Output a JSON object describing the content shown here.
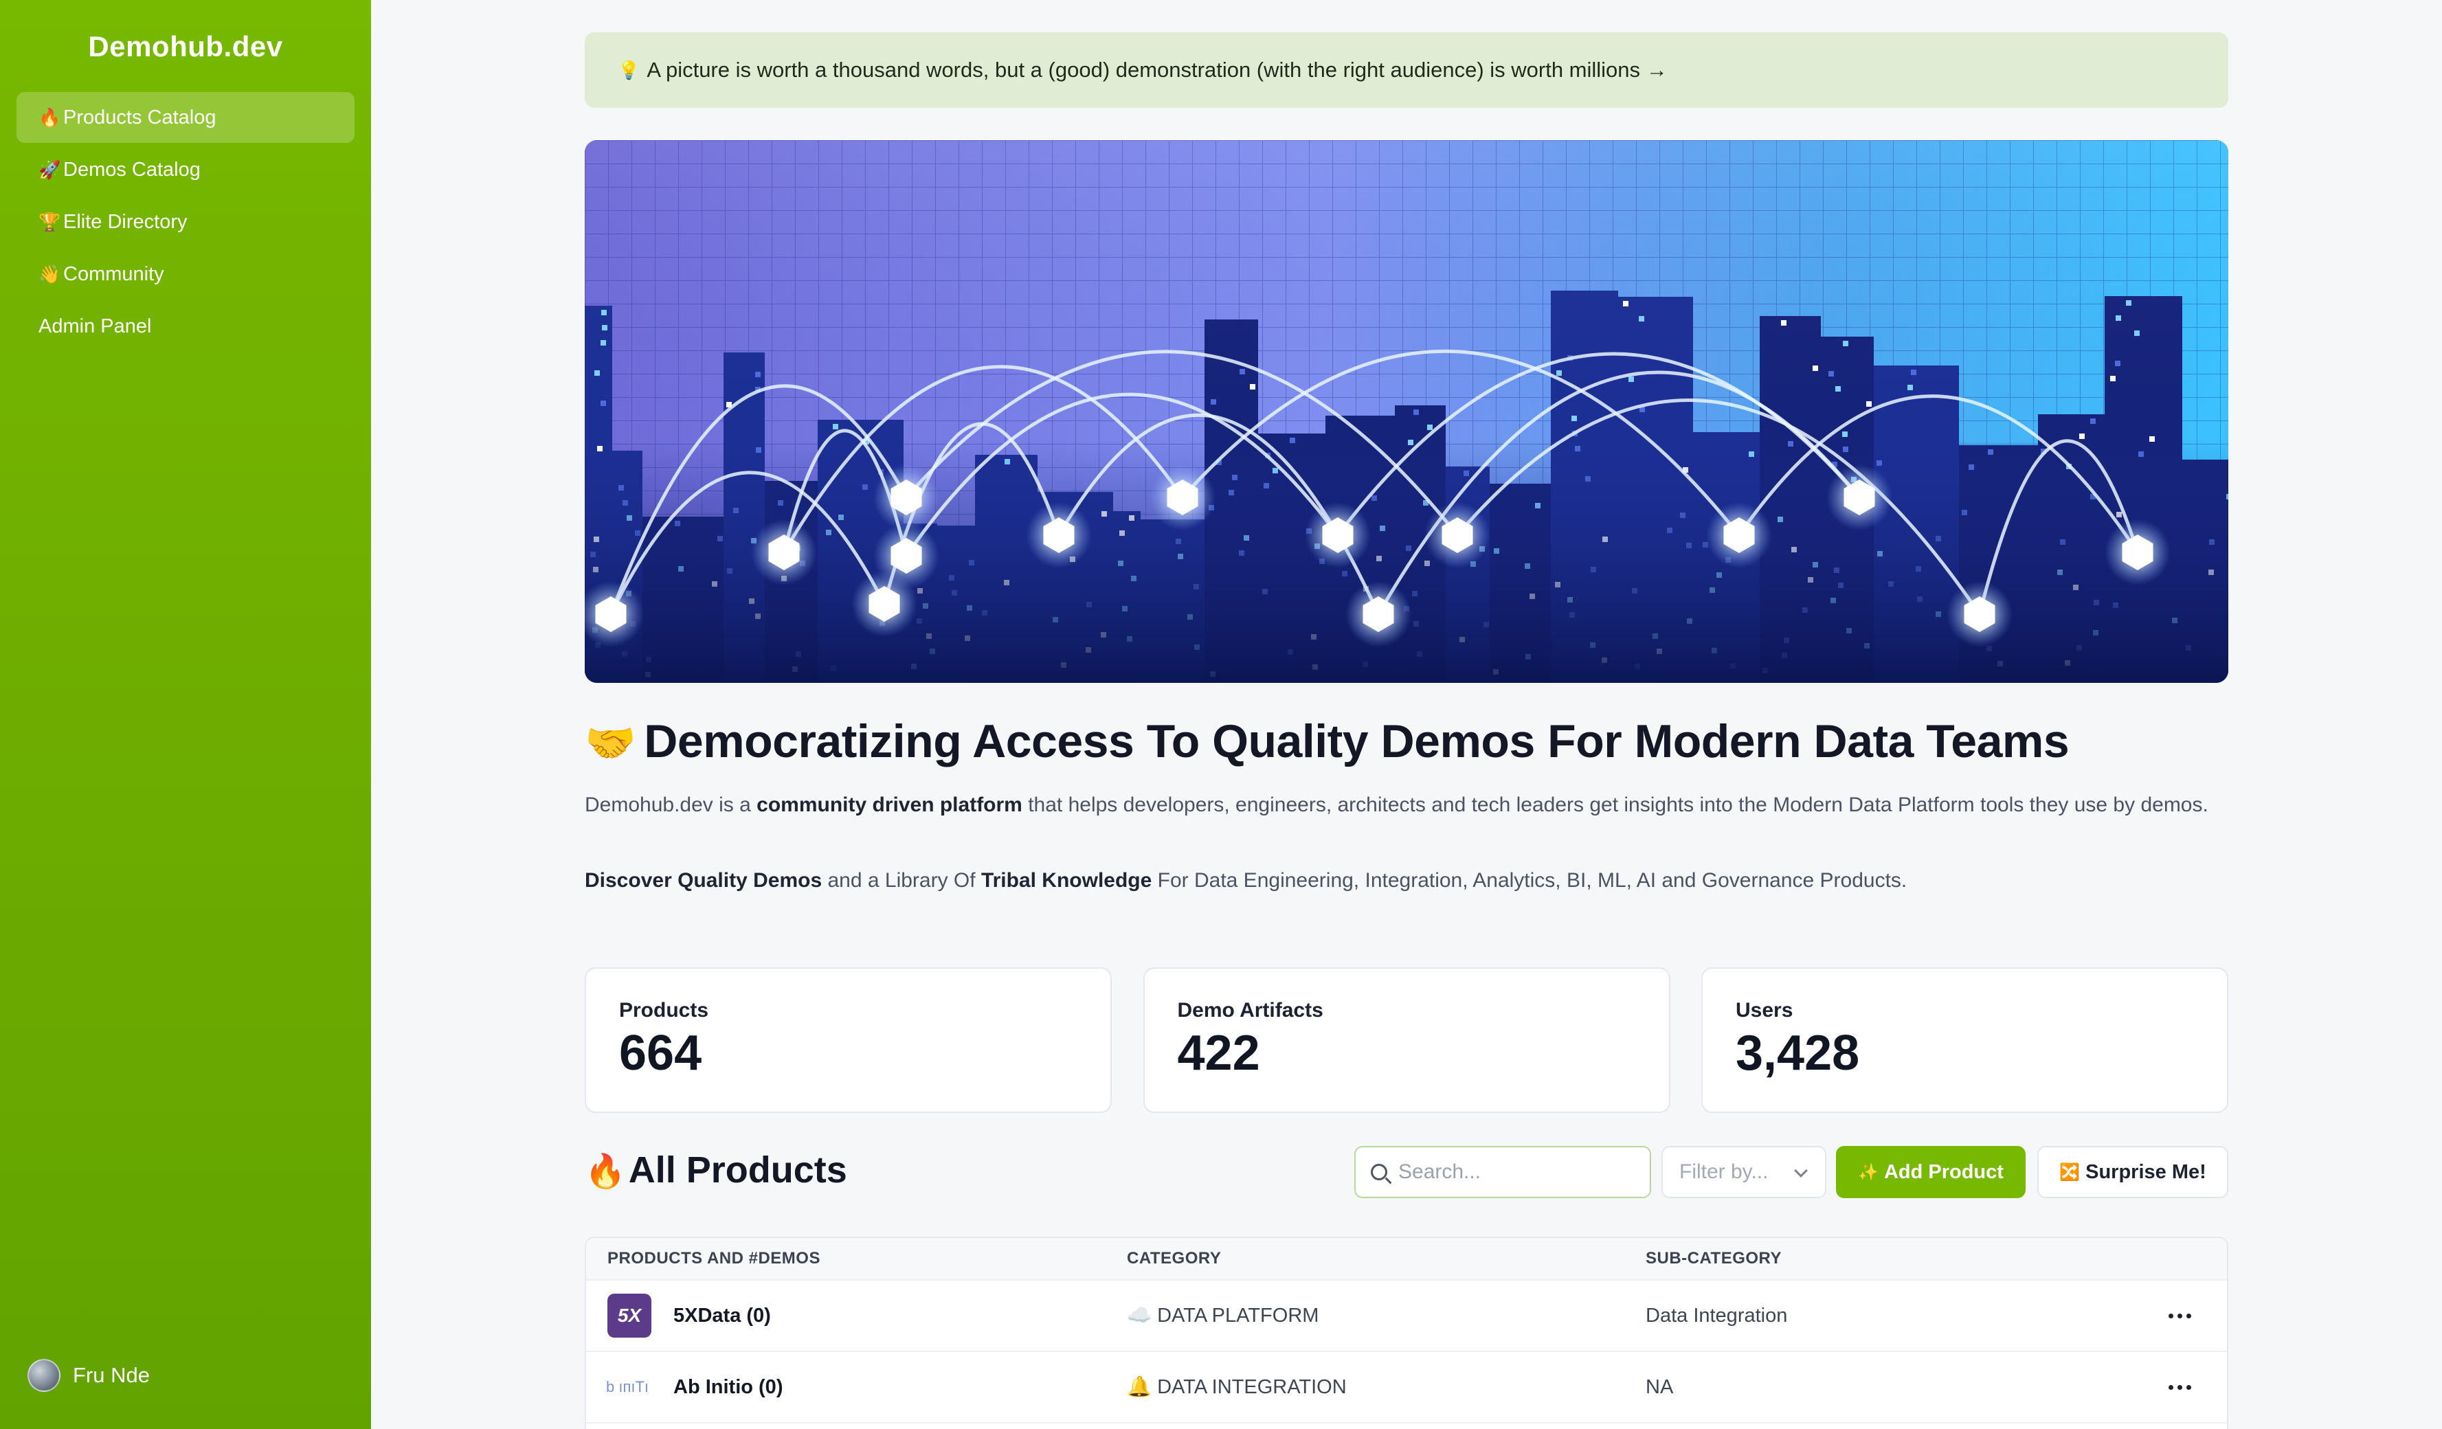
{
  "sidebar": {
    "brand": "Demohub.dev",
    "items": [
      {
        "emoji": "🔥",
        "label": "Products Catalog"
      },
      {
        "emoji": "🚀",
        "label": "Demos Catalog"
      },
      {
        "emoji": "🏆",
        "label": "Elite Directory"
      },
      {
        "emoji": "👋",
        "label": "Community"
      },
      {
        "emoji": "",
        "label": "Admin Panel"
      }
    ],
    "user_name": "Fru Nde"
  },
  "banner": {
    "emoji": "💡",
    "text": "A picture is worth a thousand words, but a (good) demonstration (with the right audience) is worth millions →"
  },
  "headline": {
    "emoji": "🤝",
    "text": "Democratizing Access To Quality Demos For Modern Data Teams"
  },
  "intro": {
    "p1_a": "Demohub.dev is a ",
    "p1_b": "community driven platform",
    "p1_c": " that helps developers, engineers, architects and tech leaders get insights into the Modern Data Platform tools they use by demos.",
    "p2_a": "Discover Quality Demos",
    "p2_b": " and a Library Of ",
    "p2_c": "Tribal Knowledge",
    "p2_d": " For Data Engineering, Integration, Analytics, BI, ML, AI and Governance Products."
  },
  "stats": [
    {
      "label": "Products",
      "value": "664"
    },
    {
      "label": "Demo Artifacts",
      "value": "422"
    },
    {
      "label": "Users",
      "value": "3,428"
    }
  ],
  "products_section": {
    "emoji": "🔥",
    "title": "All Products",
    "search_placeholder": "Search...",
    "filter_placeholder": "Filter by...",
    "add_emoji": "✨",
    "add_label": "Add Product",
    "surprise_emoji": "🔀",
    "surprise_label": "Surprise Me!"
  },
  "table": {
    "headers": [
      "PRODUCTS AND #DEMOS",
      "CATEGORY",
      "SUB-CATEGORY"
    ],
    "rows": [
      {
        "logo_text": "5X",
        "name": "5XData (0)",
        "category_emoji": "☁️",
        "category": "DATA PLATFORM",
        "subcategory": "Data Integration"
      },
      {
        "logo_text": "b ıпıTı",
        "name": "Ab Initio (0)",
        "category_emoji": "🔔",
        "category": "DATA INTEGRATION",
        "subcategory": "NA"
      }
    ]
  },
  "colors": {
    "sidebar_green": "#76b900",
    "accent_button": "#76b900",
    "banner_bg": "#e1ecd4"
  }
}
